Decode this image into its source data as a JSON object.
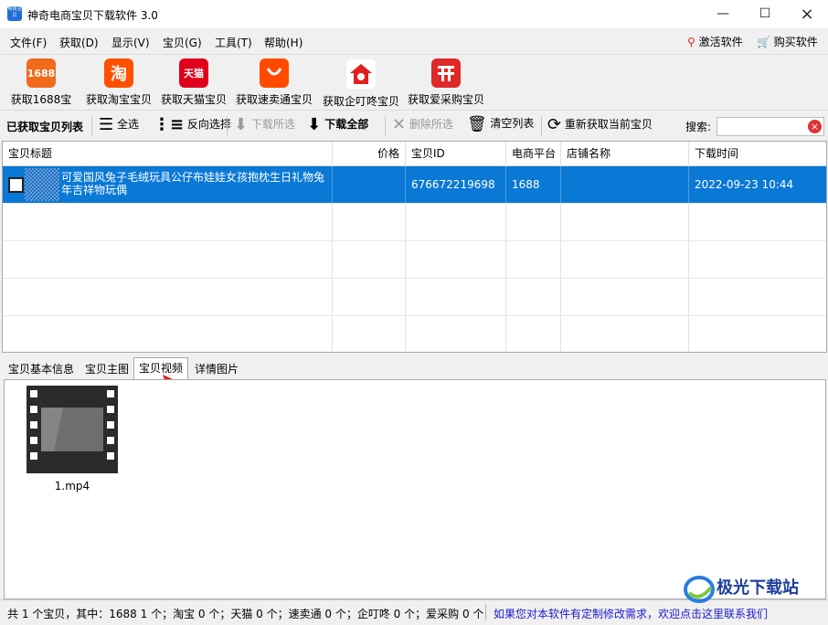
{
  "window": {
    "title": "神奇电商宝贝下载软件 3.0",
    "app_icon_text": "电商宝贝"
  },
  "menu": [
    "文件(F)",
    "获取(D)",
    "显示(V)",
    "宝贝(G)",
    "工具(T)",
    "帮助(H)"
  ],
  "menu_right": {
    "activate": "激活软件",
    "buy": "购买软件"
  },
  "toolbar_platforms": [
    {
      "label": "获取1688宝贝",
      "logo_text": "1688",
      "color": "#f26a1b"
    },
    {
      "label": "获取淘宝宝贝",
      "logo_text": "淘",
      "color": "#ff5000"
    },
    {
      "label": "获取天猫宝贝",
      "logo_text": "天猫",
      "color": "#e0001b"
    },
    {
      "label": "获取速卖通宝贝",
      "logo_text": "",
      "color": "#ff4a00"
    },
    {
      "label": "获取企叮咚宝贝",
      "logo_text": "",
      "color": "#e02020"
    },
    {
      "label": "获取爱采购宝贝",
      "logo_text": "",
      "color": "#e02828"
    }
  ],
  "toolbar2": {
    "list_label": "已获取宝贝列表",
    "select_all": "全选",
    "invert": "反向选择",
    "download_selected": "下载所选",
    "download_all": "下载全部",
    "delete_selected": "删除所选",
    "clear_list": "清空列表",
    "refetch": "重新获取当前宝贝",
    "search_label": "搜索:",
    "search_value": ""
  },
  "table": {
    "columns": [
      "宝贝标题",
      "价格",
      "宝贝ID",
      "电商平台",
      "店铺名称",
      "下载时间"
    ],
    "rows": [
      {
        "title": "可爱国风兔子毛绒玩具公仔布娃娃女孩抱枕生日礼物兔年吉祥物玩偶",
        "price": "",
        "id": "676672219698",
        "platform": "1688",
        "shop": "",
        "time": "2022-09-23 10:44"
      }
    ]
  },
  "tabs": [
    "宝贝基本信息",
    "宝贝主图",
    "宝贝视频",
    "详情图片"
  ],
  "active_tab": "宝贝视频",
  "videos": [
    {
      "file": "1.mp4",
      "icon": "film-icon"
    }
  ],
  "status": {
    "summary": "共 1 个宝贝，其中：1688 1 个；淘宝 0 个；天猫 0 个；速卖通 0 个；企叮咚 0 个；爱采购 0 个",
    "link": "如果您对本软件有定制修改需求，欢迎点击这里联系我们"
  },
  "watermark": "极光下载站",
  "colors": {
    "selection": "#0a79d6",
    "accent_red": "#e02020"
  }
}
